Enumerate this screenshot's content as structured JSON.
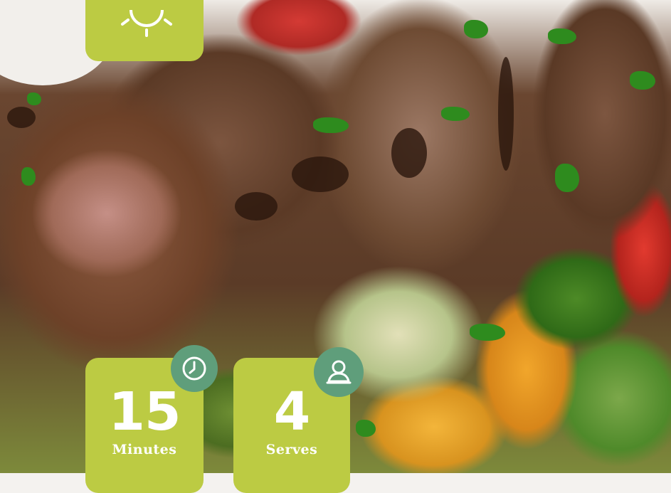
{
  "tiles": {
    "top": {
      "icon": "sun-icon"
    },
    "time": {
      "value": "15",
      "label": "Minutes",
      "icon": "clock-icon"
    },
    "serves": {
      "value": "4",
      "label": "Serves",
      "icon": "person-icon"
    }
  },
  "colors": {
    "tile_background": "#bccb43",
    "badge_background": "#5f9e7b",
    "text": "#ffffff"
  },
  "image": {
    "subject": "food-photo"
  }
}
